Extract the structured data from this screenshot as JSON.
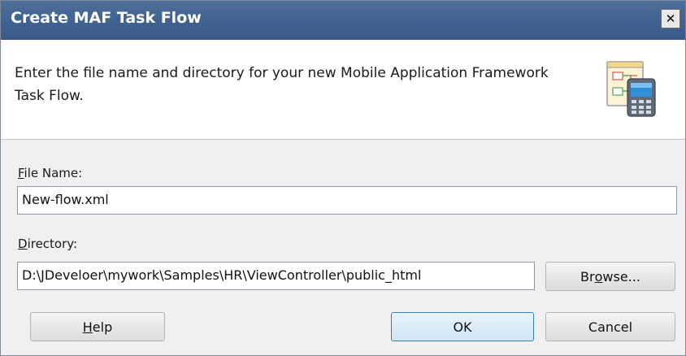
{
  "window": {
    "title": "Create MAF Task Flow",
    "close_glyph": "✕"
  },
  "header": {
    "description": "Enter the file name and directory for your new Mobile Application Framework Task Flow.",
    "icon": "mobile-task-flow-icon"
  },
  "form": {
    "file_name_label_mnemonic": "F",
    "file_name_label_rest": "ile Name:",
    "file_name_value": "New-flow.xml",
    "directory_label_mnemonic": "D",
    "directory_label_rest": "irectory:",
    "directory_value": "D:\\JDeveloer\\mywork\\Samples\\HR\\ViewController\\public_html"
  },
  "buttons": {
    "browse_pre": "Br",
    "browse_mnemonic": "o",
    "browse_post": "wse...",
    "help_mnemonic": "H",
    "help_post": "elp",
    "ok_label": "OK",
    "cancel_label": "Cancel"
  },
  "colors": {
    "titlebar": "#3f6290",
    "dialog_bg": "#f0f0f0",
    "default_button_border": "#3c7fb1"
  }
}
